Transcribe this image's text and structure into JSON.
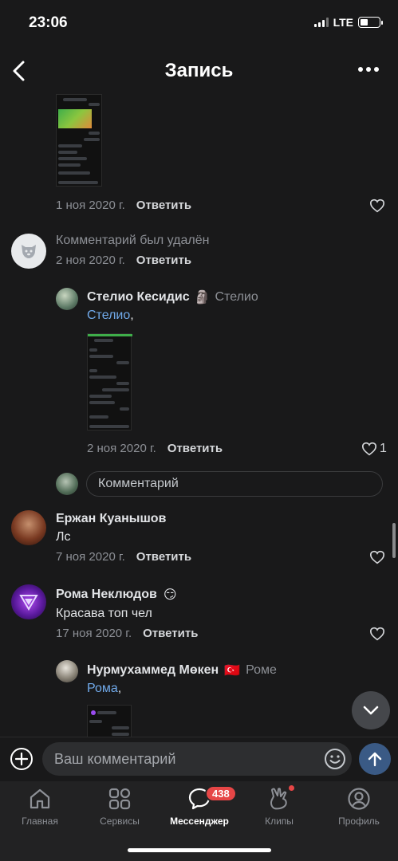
{
  "status": {
    "time": "23:06",
    "network": "LTE"
  },
  "header": {
    "title": "Запись"
  },
  "comments": [
    {
      "date": "1 ноя 2020 г.",
      "reply": "Ответить"
    },
    {
      "text": "Комментарий был удалён",
      "date": "2 ноя 2020 г.",
      "reply": "Ответить"
    },
    {
      "name": "Стелио Кесидис",
      "emoji": "🗿",
      "reply_to": "Стелио",
      "mention": "Стелио",
      "mention_suffix": ",",
      "date": "2 ноя 2020 г.",
      "reply": "Ответить",
      "likes": "1"
    },
    {
      "name": "Ержан Куанышов",
      "text": "Лс",
      "date": "7 ноя 2020 г.",
      "reply": "Ответить"
    },
    {
      "name": "Рома Неклюдов",
      "emoji": "😏",
      "text": "Красава топ чел",
      "date": "17 ноя 2020 г.",
      "reply": "Ответить"
    },
    {
      "name": "Нурмухаммед Мөкен",
      "emoji": "🇹🇷",
      "reply_to": "Роме",
      "mention": "Рома",
      "mention_suffix": ","
    }
  ],
  "inline_comment": {
    "placeholder": "Комментарий"
  },
  "composer": {
    "placeholder": "Ваш комментарий"
  },
  "tabs": [
    {
      "label": "Главная",
      "icon": "home-icon"
    },
    {
      "label": "Сервисы",
      "icon": "services-icon"
    },
    {
      "label": "Мессенджер",
      "icon": "messenger-icon",
      "badge": "438"
    },
    {
      "label": "Клипы",
      "icon": "clips-icon"
    },
    {
      "label": "Профиль",
      "icon": "profile-icon"
    }
  ],
  "colors": {
    "background": "#19191a",
    "accent": "#71aaeb",
    "badge": "#e64646"
  }
}
